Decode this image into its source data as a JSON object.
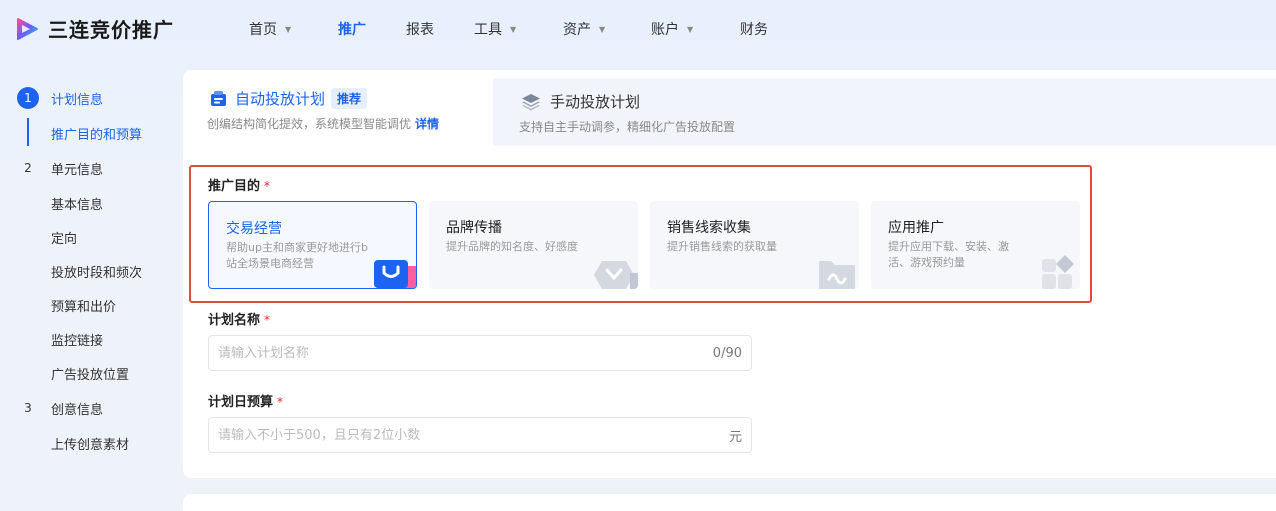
{
  "app": {
    "title": "三连竞价推广"
  },
  "nav": {
    "items": [
      {
        "label": "首页",
        "has_caret": true
      },
      {
        "label": "推广",
        "has_caret": false,
        "active": true
      },
      {
        "label": "报表",
        "has_caret": false
      },
      {
        "label": "工具",
        "has_caret": true
      },
      {
        "label": "资产",
        "has_caret": true
      },
      {
        "label": "账户",
        "has_caret": true
      },
      {
        "label": "财务",
        "has_caret": false
      }
    ]
  },
  "steps": {
    "groups": [
      {
        "num": "1",
        "label": "计划信息",
        "active": true,
        "subs": [
          "推广目的和预算"
        ]
      },
      {
        "num": "2",
        "label": "单元信息",
        "subs": [
          "基本信息",
          "定向",
          "投放时段和频次",
          "预算和出价",
          "监控链接",
          "广告投放位置"
        ]
      },
      {
        "num": "3",
        "label": "创意信息",
        "subs": [
          "上传创意素材"
        ]
      }
    ]
  },
  "tabs": {
    "auto": {
      "title": "自动投放计划",
      "tag": "推荐",
      "desc": "创编结构简化提效，系统模型智能调优",
      "link": "详情"
    },
    "manual": {
      "title": "手动投放计划",
      "desc": "支持自主手动调参，精细化广告投放配置"
    }
  },
  "purpose": {
    "label": "推广目的",
    "required_mark": "*",
    "cards": [
      {
        "title": "交易经营",
        "desc": "帮助up主和商家更好地进行b站全场景电商经营",
        "selected": true
      },
      {
        "title": "品牌传播",
        "desc": "提升品牌的知名度、好感度"
      },
      {
        "title": "销售线索收集",
        "desc": "提升销售线索的获取量"
      },
      {
        "title": "应用推广",
        "desc": "提升应用下载、安装、激活、游戏预约量"
      }
    ]
  },
  "plan_name": {
    "label": "计划名称",
    "required_mark": "*",
    "placeholder": "请输入计划名称",
    "counter": "0/90"
  },
  "daily_budget": {
    "label": "计划日预算",
    "required_mark": "*",
    "placeholder": "请输入不小于500，且只有2位小数",
    "unit": "元"
  },
  "colors": {
    "accent": "#1d63f1",
    "highlight": "#e04a3f",
    "required": "#f5222d"
  }
}
